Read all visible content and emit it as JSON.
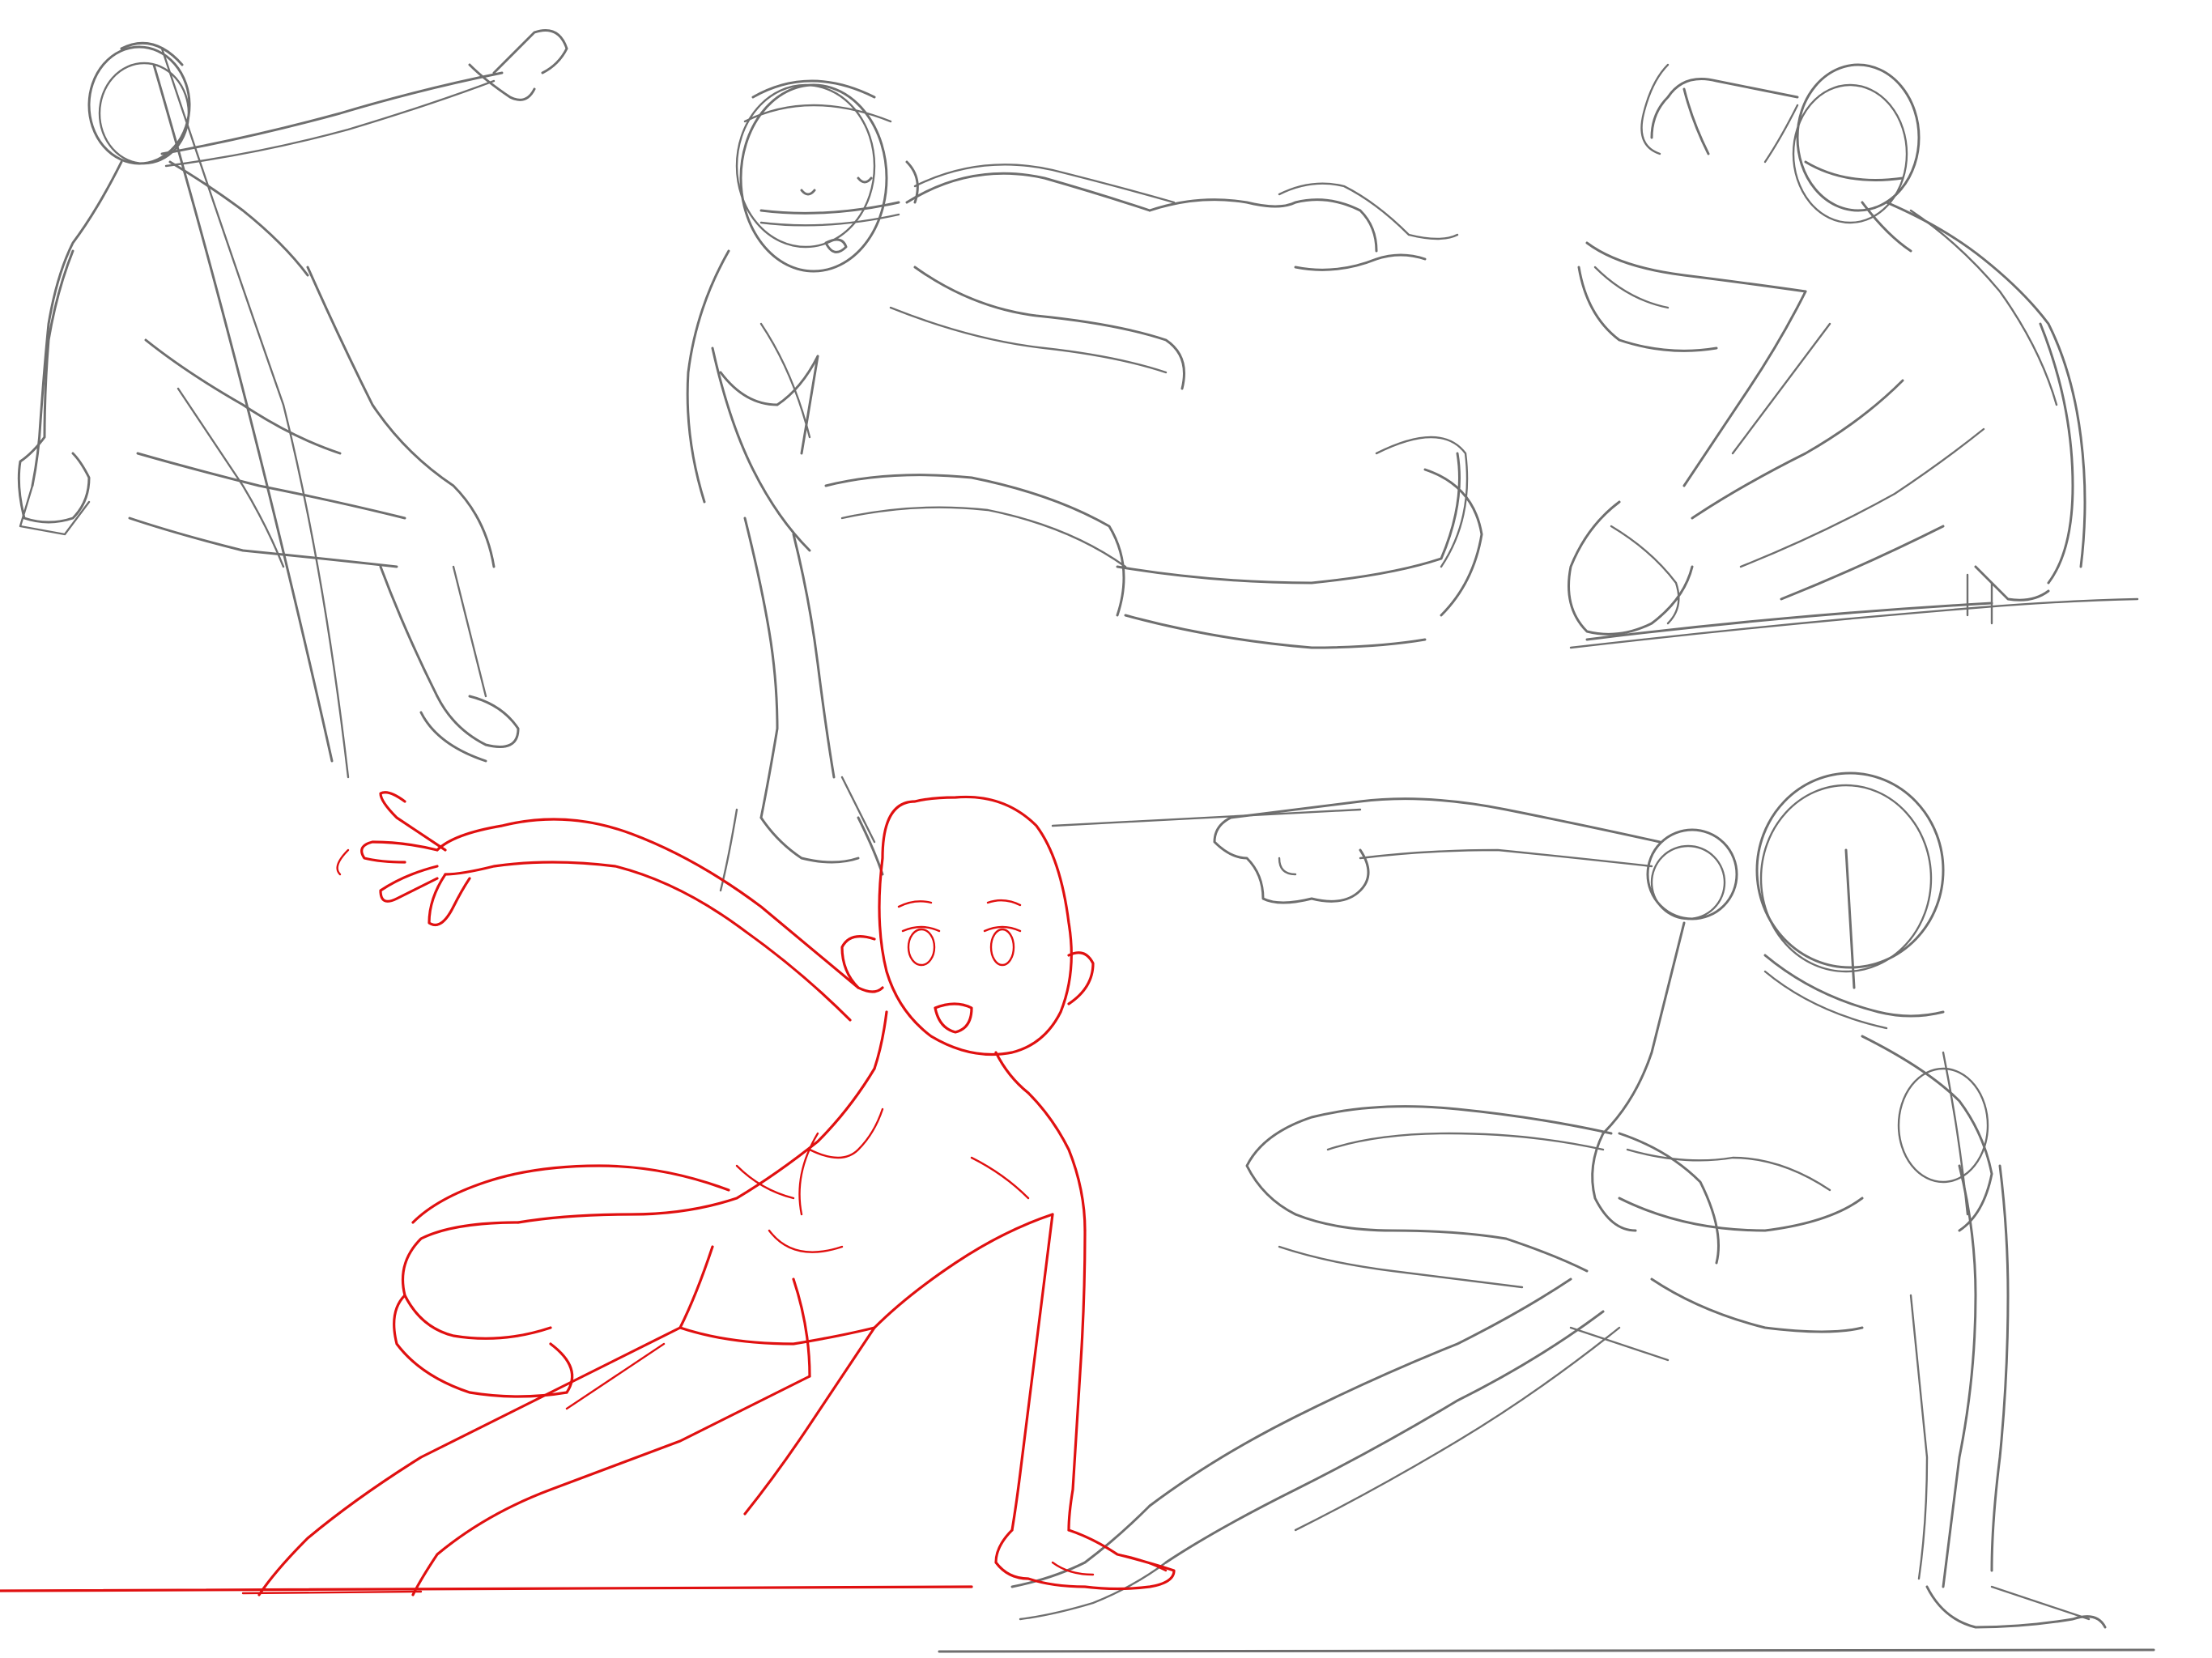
{
  "canvas": {
    "background": "#ffffff"
  },
  "sketches": [
    {
      "name": "pose-sketch-1",
      "color": "#6f6f6f"
    },
    {
      "name": "pose-sketch-2",
      "color": "#6f6f6f"
    },
    {
      "name": "pose-sketch-3",
      "color": "#6f6f6f"
    },
    {
      "name": "pose-sketch-4",
      "color": "#6f6f6f"
    },
    {
      "name": "pose-sketch-red",
      "color": "#e01010"
    }
  ]
}
